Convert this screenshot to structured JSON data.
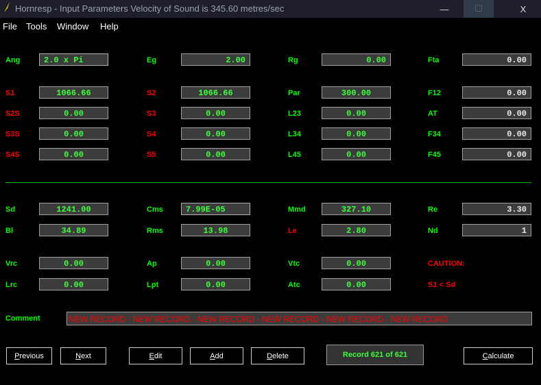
{
  "window": {
    "title": "Hornresp - Input Parameters   Velocity of Sound is 345.60 metres/sec",
    "minimize": "—",
    "maximize": "☐",
    "close": "X"
  },
  "menu": [
    "File",
    "Tools",
    "Window",
    "Help"
  ],
  "params": {
    "ang": {
      "label": "Ang",
      "value": "2.0 x Pi"
    },
    "eg": {
      "label": "Eg",
      "value": "2.00"
    },
    "rg": {
      "label": "Rg",
      "value": "0.00"
    },
    "fta": {
      "label": "Fta",
      "value": "0.00"
    },
    "s1": {
      "label": "S1",
      "value": "1066.66"
    },
    "s2": {
      "label": "S2",
      "value": "1066.66"
    },
    "par": {
      "label": "Par",
      "value": "300.00"
    },
    "f12": {
      "label": "F12",
      "value": "0.00"
    },
    "s2s": {
      "label": "S2S",
      "value": "0.00"
    },
    "s3": {
      "label": "S3",
      "value": "0.00"
    },
    "l23": {
      "label": "L23",
      "value": "0.00"
    },
    "at": {
      "label": "AT",
      "value": "0.00"
    },
    "s3s": {
      "label": "S3S",
      "value": "0.00"
    },
    "s4": {
      "label": "S4",
      "value": "0.00"
    },
    "l34": {
      "label": "L34",
      "value": "0.00"
    },
    "f34": {
      "label": "F34",
      "value": "0.00"
    },
    "s4s": {
      "label": "S4S",
      "value": "0.00"
    },
    "s5": {
      "label": "S5",
      "value": "0.00"
    },
    "l45": {
      "label": "L45",
      "value": "0.00"
    },
    "f45": {
      "label": "F45",
      "value": "0.00"
    },
    "sd": {
      "label": "Sd",
      "value": "1241.00"
    },
    "cms": {
      "label": "Cms",
      "value": "7.99E-05"
    },
    "mmd": {
      "label": "Mmd",
      "value": "327.10"
    },
    "re": {
      "label": "Re",
      "value": "3.30"
    },
    "bl": {
      "label": "Bl",
      "value": "34.89"
    },
    "rms": {
      "label": "Rms",
      "value": "13.98"
    },
    "le": {
      "label": "Le",
      "value": "2.80"
    },
    "nd": {
      "label": "Nd",
      "value": "1"
    },
    "vrc": {
      "label": "Vrc",
      "value": "0.00"
    },
    "ap": {
      "label": "Ap",
      "value": "0.00"
    },
    "vtc": {
      "label": "Vtc",
      "value": "0.00"
    },
    "lrc": {
      "label": "Lrc",
      "value": "0.00"
    },
    "lpt": {
      "label": "Lpt",
      "value": "0.00"
    },
    "atc": {
      "label": "Atc",
      "value": "0.00"
    }
  },
  "caution": {
    "title": "CAUTION:",
    "message": "S1 < Sd"
  },
  "comment": {
    "label": "Comment",
    "value": "NEW RECORD - NEW RECORD - NEW RECORD - NEW RECORD - NEW RECORD - NEW RECORD"
  },
  "buttons": {
    "previous": {
      "mnemonic": "P",
      "rest": "revious"
    },
    "next": {
      "mnemonic": "N",
      "rest": "ext"
    },
    "edit": {
      "mnemonic": "E",
      "rest": "dit"
    },
    "add": {
      "mnemonic": "A",
      "rest": "dd"
    },
    "delete": {
      "mnemonic": "D",
      "rest": "elete"
    },
    "calculate": {
      "mnemonic": "C",
      "rest": "alculate"
    }
  },
  "record": "Record 621 of 621",
  "colors": {
    "label_green": "#00ff00",
    "label_red": "#ff0000",
    "value_green": "#3cff3c",
    "separator": "#00b000"
  }
}
